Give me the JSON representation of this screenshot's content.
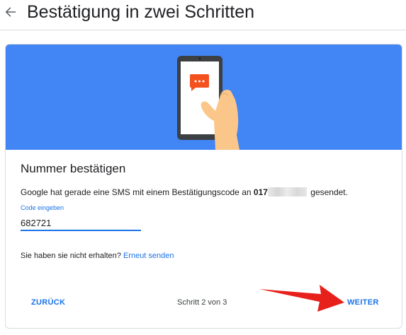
{
  "header": {
    "title": "Bestätigung in zwei Schritten",
    "back_icon": "arrow-back-icon"
  },
  "card": {
    "title": "Nummer bestätigen",
    "description_prefix": "Google hat gerade eine SMS mit einem Bestätigungscode an",
    "phone_prefix": "017",
    "description_suffix": "gesendet.",
    "code_label": "Code eingeben",
    "code_value": "682721",
    "resend_question": "Sie haben sie nicht erhalten?",
    "resend_link": "Erneut senden",
    "back_button": "ZURÜCK",
    "step_text": "Schritt 2 von 3",
    "next_button": "WEITER"
  },
  "colors": {
    "banner": "#4285f4",
    "accent": "#1a73e8",
    "annotation_arrow": "#e8201c",
    "chat_bubble": "#f4511e",
    "hand": "#fbc68a"
  }
}
